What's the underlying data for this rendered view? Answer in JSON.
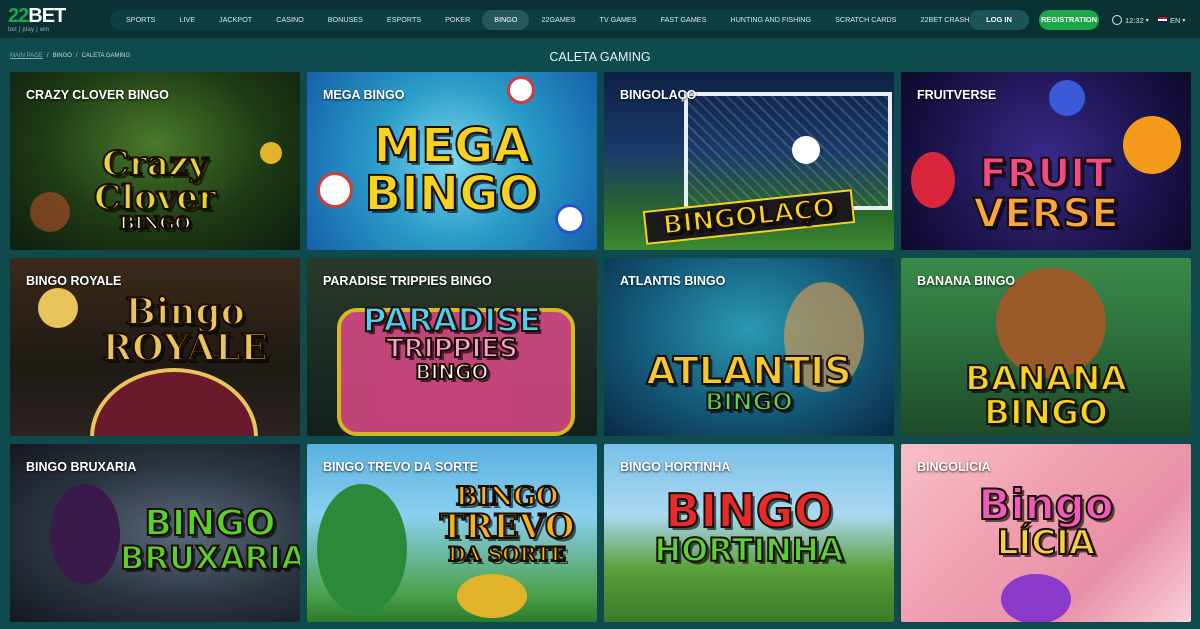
{
  "brand": {
    "name_num": "22",
    "name_text": "BET",
    "tagline": "bet | play | win"
  },
  "nav": [
    "SPORTS",
    "LIVE",
    "JACKPOT",
    "CASINO",
    "BONUSES",
    "ESPORTS",
    "POKER",
    "BINGO",
    "22GAMES",
    "TV GAMES",
    "FAST GAMES",
    "HUNTING AND FISHING",
    "SCRATCH CARDS",
    "22BET CRASH"
  ],
  "nav_active": "BINGO",
  "auth": {
    "login": "LOG IN",
    "register": "REGISTRATION"
  },
  "time": "12:32",
  "lang": "EN",
  "breadcrumb": {
    "home": "MAIN PAGE",
    "section": "BINGO",
    "current": "CALETA GAMING",
    "sep": "/"
  },
  "page_title": "CALETA GAMING",
  "colors": {
    "bg": "#0f4a4d",
    "topbar": "#0a3235",
    "register": "#1aa84a"
  },
  "games": [
    {
      "title": "CRAZY CLOVER BINGO",
      "art": [
        "Crazy",
        "Clover",
        "BINGO"
      ]
    },
    {
      "title": "MEGA BINGO",
      "art": [
        "MEGA",
        "BINGO"
      ]
    },
    {
      "title": "BINGOLAÇO",
      "art": [
        "BINGOLAÇO"
      ]
    },
    {
      "title": "FRUITVERSE",
      "art": [
        "FRUIT",
        "VERSE"
      ]
    },
    {
      "title": "BINGO ROYALE",
      "art": [
        "Bingo",
        "ROYALE"
      ]
    },
    {
      "title": "PARADISE TRIPPIES BINGO",
      "art": [
        "PARADISE",
        "TRIPPIES",
        "BINGO"
      ]
    },
    {
      "title": "ATLANTIS BINGO",
      "art": [
        "ATLANTIS",
        "BINGO"
      ]
    },
    {
      "title": "BANANA BINGO",
      "art": [
        "BANANA",
        "BINGO"
      ]
    },
    {
      "title": "BINGO BRUXARIA",
      "art": [
        "BINGO",
        "BRUXARIA"
      ]
    },
    {
      "title": "BINGO TREVO DA SORTE",
      "art": [
        "BINGO",
        "TREVO",
        "DA SORTE"
      ]
    },
    {
      "title": "BINGO HORTINHA",
      "art": [
        "BINGO",
        "HORTINHA"
      ]
    },
    {
      "title": "BINGOLÍCIA",
      "art": [
        "Bingo",
        "LÍCIA"
      ]
    }
  ]
}
